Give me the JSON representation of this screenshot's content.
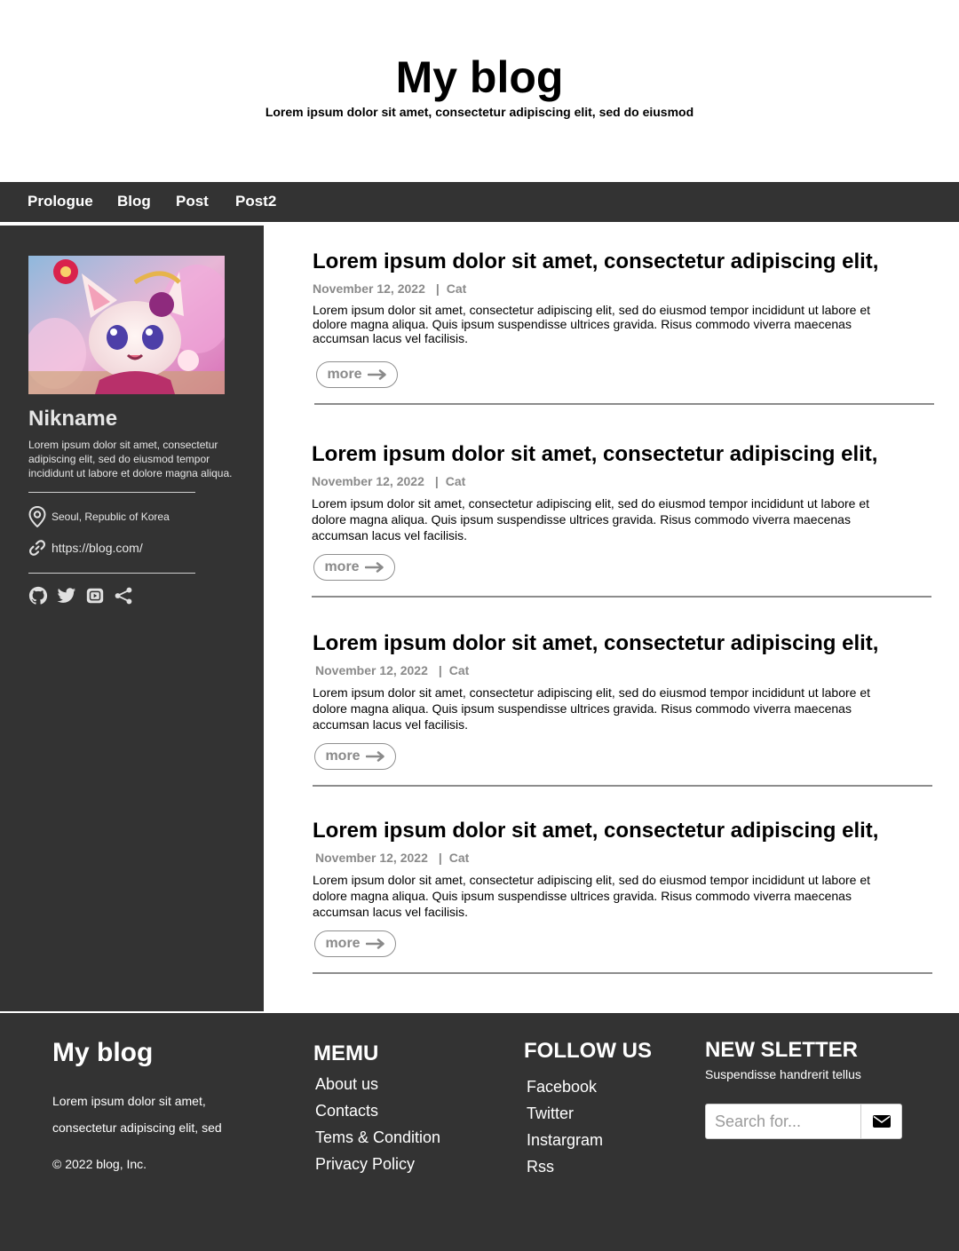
{
  "header": {
    "title": "My blog",
    "subtitle": "Lorem ipsum dolor sit amet, consectetur adipiscing elit, sed do eiusmod"
  },
  "nav": {
    "items": [
      {
        "label": "Prologue"
      },
      {
        "label": "Blog"
      },
      {
        "label": "Post"
      },
      {
        "label": "Post2"
      }
    ]
  },
  "sidebar": {
    "nickname": "Nikname",
    "bio": "Lorem ipsum dolor sit amet, consectetur adipiscing elit, sed do eiusmod tempor incididunt ut labore et dolore magna aliqua.",
    "location": "Seoul, Republic of Korea",
    "link": "https://blog.com/",
    "social_icons": [
      "github-icon",
      "twitter-icon",
      "youtube-icon",
      "share-icon"
    ]
  },
  "posts": [
    {
      "title": "Lorem ipsum dolor sit amet, consectetur adipiscing elit,",
      "date": "November 12, 2022",
      "category": "Cat",
      "body": "Lorem ipsum dolor sit amet, consectetur adipiscing elit, sed do eiusmod tempor incididunt ut labore et dolore magna aliqua. Quis ipsum suspendisse ultrices gravida. Risus commodo viverra maecenas accumsan lacus vel facilisis.",
      "more_label": "more"
    },
    {
      "title": "Lorem ipsum dolor sit amet, consectetur adipiscing elit,",
      "date": "November 12, 2022",
      "category": "Cat",
      "body": "Lorem ipsum dolor sit amet, consectetur adipiscing elit, sed do eiusmod tempor incididunt ut labore et dolore magna aliqua. Quis ipsum suspendisse ultrices gravida. Risus commodo viverra maecenas accumsan lacus vel facilisis.",
      "more_label": "more"
    },
    {
      "title": "Lorem ipsum dolor sit amet, consectetur adipiscing elit,",
      "date": "November 12, 2022",
      "category": "Cat",
      "body": "Lorem ipsum dolor sit amet, consectetur adipiscing elit, sed do eiusmod tempor incididunt ut labore et dolore magna aliqua. Quis ipsum suspendisse ultrices gravida. Risus commodo viverra maecenas accumsan lacus vel facilisis.",
      "more_label": "more"
    },
    {
      "title": "Lorem ipsum dolor sit amet, consectetur adipiscing elit,",
      "date": "November 12, 2022",
      "category": "Cat",
      "body": "Lorem ipsum dolor sit amet, consectetur adipiscing elit, sed do eiusmod tempor incididunt ut labore et dolore magna aliqua. Quis ipsum suspendisse ultrices gravida. Risus commodo viverra maecenas accumsan lacus vel facilisis.",
      "more_label": "more"
    }
  ],
  "footer": {
    "title": "My blog",
    "text": "Lorem ipsum dolor sit amet, consectetur adipiscing elit, sed",
    "copyright": "© 2022 blog, Inc.",
    "menu_heading": "MEMU",
    "menu_items": [
      "About us",
      "Contacts",
      "Tems &  Condition",
      "Privacy Policy"
    ],
    "follow_heading": "FOLLOW US",
    "follow_items": [
      "Facebook",
      "Twitter",
      "Instargram",
      "Rss"
    ],
    "newsletter_heading": "NEW SLETTER",
    "newsletter_sub": "Suspendisse handrerit tellus",
    "search_placeholder": "Search for..."
  },
  "colors": {
    "dark": "#333333",
    "meta_gray": "#8a8a8a"
  }
}
